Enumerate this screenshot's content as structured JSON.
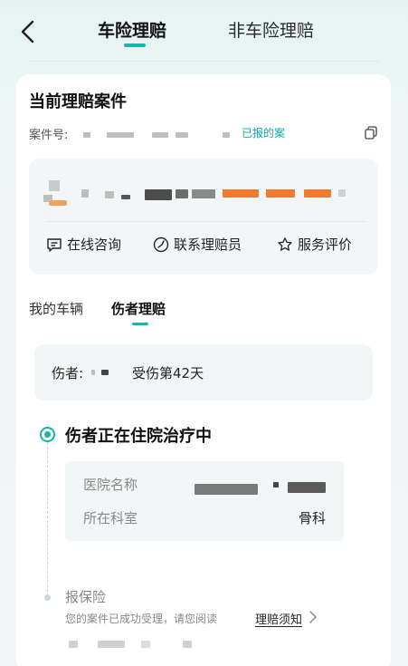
{
  "header": {
    "tabs": [
      "车险理赔",
      "非车险理赔"
    ],
    "active_tab": 0
  },
  "case": {
    "title": "当前理赔案件",
    "number_label": "案件号:",
    "status": "已报的案",
    "actions": [
      "在线咨询",
      "联系理赔员",
      "服务评价"
    ]
  },
  "subtabs": [
    "我的车辆",
    "伤者理赔"
  ],
  "injury": {
    "label": "伤者:",
    "days_text": "受伤第42天"
  },
  "timeline": {
    "step1": {
      "title": "伤者正在住院治疗中",
      "hospital_label": "医院名称",
      "department_label": "所在科室",
      "department_value": "骨科"
    },
    "step2": {
      "title": "报保险",
      "desc": "您的案件已成功受理，请您阅读",
      "link": "理赔须知"
    }
  },
  "colors": {
    "accent": "#14b8a6",
    "card_bg": "#ffffff",
    "panel_bg": "#f3f6f7"
  }
}
